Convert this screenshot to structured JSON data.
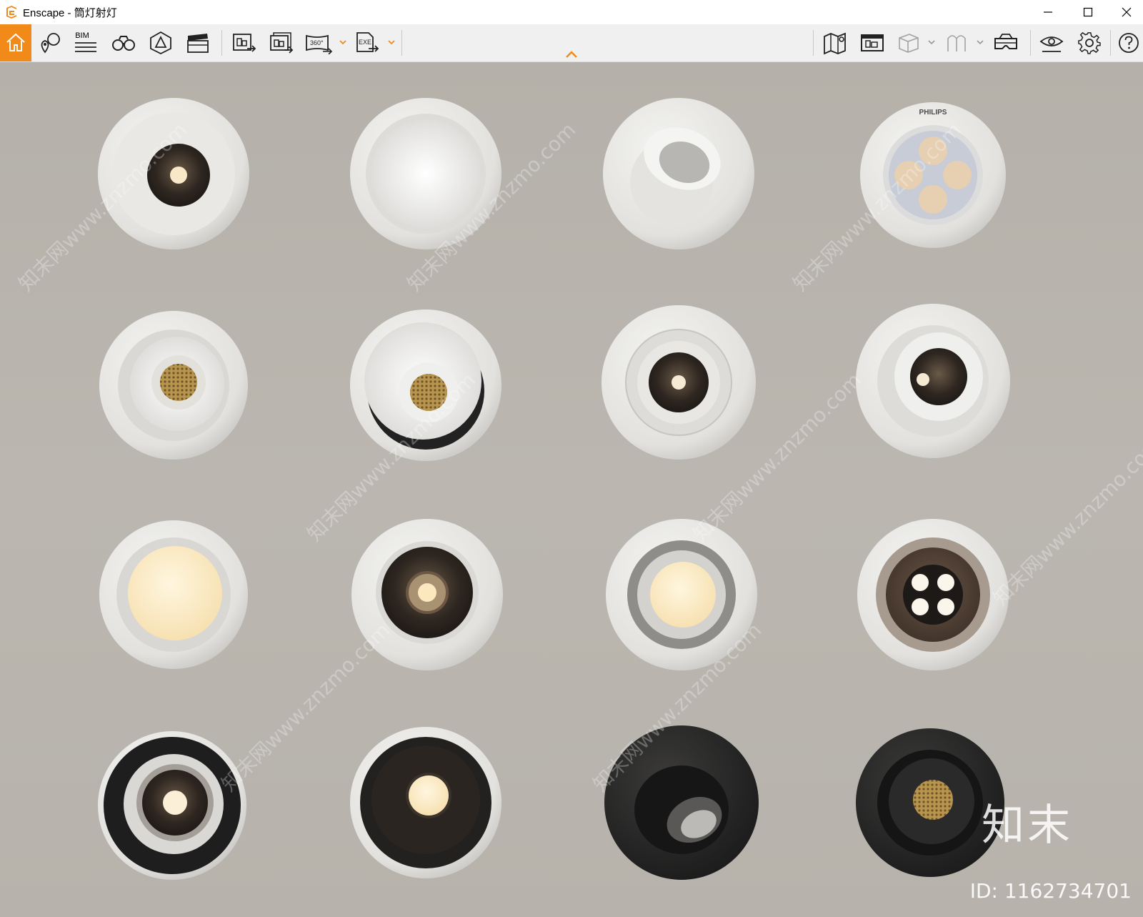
{
  "window": {
    "app_name": "Enscape",
    "separator": " - ",
    "project_name": "筒灯射灯"
  },
  "toolbar": {
    "bim_label": "BIM",
    "pano_label": "360°",
    "exe_label": "EXE"
  },
  "watermark": {
    "site": "知末网www.znzmo.com",
    "brand": "知末",
    "image_id": "ID: 1162734701"
  },
  "product_label": "PHILIPS",
  "colors": {
    "accent": "#f28a1a",
    "background": "#b8b4ae"
  },
  "fixtures": [
    {
      "name": "downlight-white-black-lens"
    },
    {
      "name": "downlight-white-plain"
    },
    {
      "name": "spotlight-white-tilted"
    },
    {
      "name": "downlight-philips-4-led"
    },
    {
      "name": "spotlight-white-honeycomb"
    },
    {
      "name": "spotlight-white-honeycomb-tilt"
    },
    {
      "name": "downlight-white-deep-dark"
    },
    {
      "name": "downlight-white-offset-dark"
    },
    {
      "name": "downlight-white-warm-panel"
    },
    {
      "name": "downlight-white-bronze-reflector"
    },
    {
      "name": "downlight-white-grey-ring-warm"
    },
    {
      "name": "downlight-white-bronze-4-led"
    },
    {
      "name": "downlight-black-white-ring"
    },
    {
      "name": "downlight-white-black-warm"
    },
    {
      "name": "spotlight-black-tilted"
    },
    {
      "name": "spotlight-black-honeycomb"
    }
  ]
}
